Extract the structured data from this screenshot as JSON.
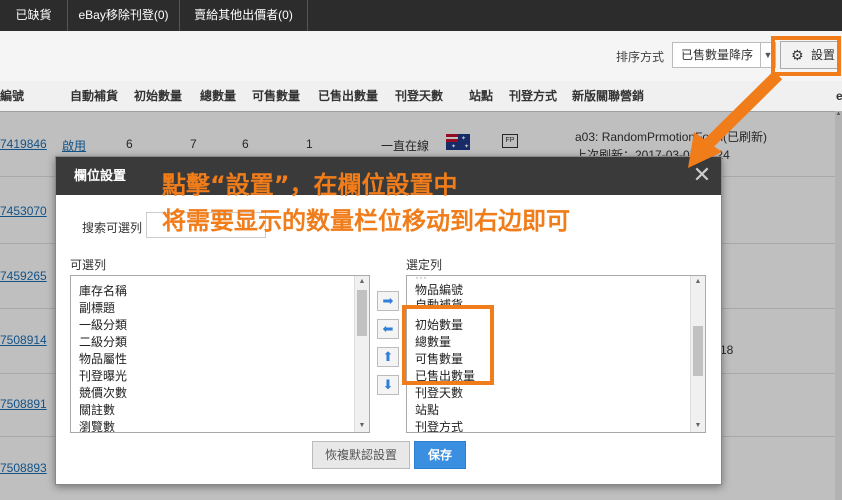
{
  "tabs": [
    "已缺貨",
    "eBay移除刊登(0)",
    "賣給其他出價者(0)"
  ],
  "toolbar": {
    "sort_label": "排序方式",
    "sort_value": "已售數量降序",
    "settings_label": "設置",
    "gear_icon": "gear-icon"
  },
  "table": {
    "headers": [
      "編號",
      "自動補貨",
      "初始數量",
      "總數量",
      "可售數量",
      "已售出數量",
      "刊登天數",
      "站點",
      "刊登方式",
      "新版關聯營銷",
      "e"
    ],
    "rows": [
      {
        "sku": "7419846",
        "auto": "啟用",
        "initial": "6",
        "total": "7",
        "available": "6",
        "sold": "1",
        "days": "一直在線",
        "marketing_line1": "a03: RandomPrmotionForm(已刷新)",
        "marketing_line2": "上次刷新：2017-03-05 00:24"
      },
      {
        "sku": "7453070"
      },
      {
        "sku": "7459265"
      },
      {
        "sku": "7508914",
        "extra": "18"
      },
      {
        "sku": "7508891"
      },
      {
        "sku": "7508893"
      }
    ]
  },
  "modal": {
    "title": "欄位設置",
    "search_label": "搜索可選列",
    "search_placeholder": "",
    "available_label": "可選列",
    "selected_label": "選定列",
    "available_items": [
      "庫存名稱",
      "副標題",
      "一級分類",
      "二級分類",
      "物品屬性",
      "刊登曝光",
      "競價次數",
      "關註數",
      "瀏覽數"
    ],
    "selected_items": [
      "物品編號",
      "自動補貨",
      "初始數量",
      "總數量",
      "可售數量",
      "已售出數量",
      "刊登天數",
      "站點",
      "刊登方式"
    ],
    "reset_label": "恢複默認設置",
    "save_label": "保存",
    "close_glyph": "✕"
  },
  "annotation": {
    "line1": "點擊“設置”，在欄位設置中",
    "line2": "将需要显示的数量栏位移动到右边即可",
    "color": "#f07c1a"
  }
}
